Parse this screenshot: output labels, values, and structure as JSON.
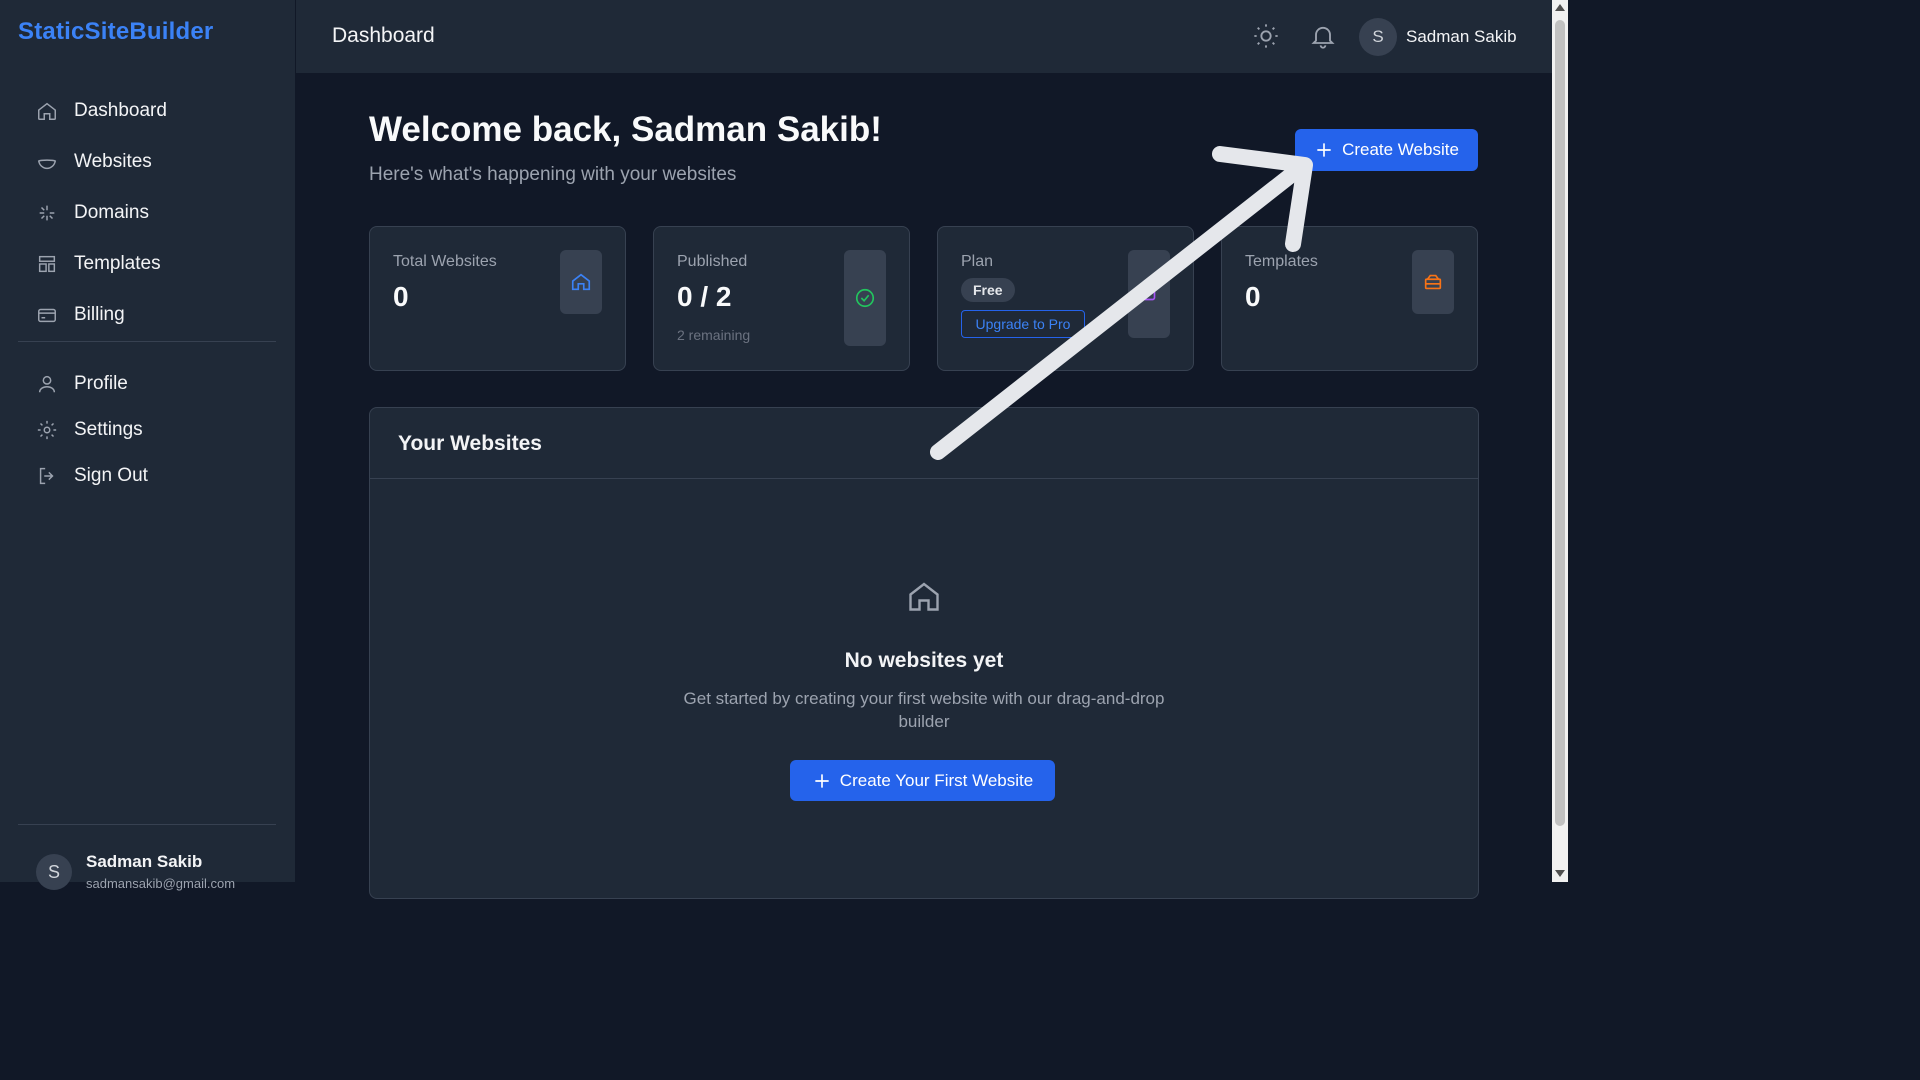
{
  "brand": "StaticSiteBuilder",
  "nav": {
    "primary": [
      {
        "label": "Dashboard",
        "icon": "home-icon"
      },
      {
        "label": "Websites",
        "icon": "bowl-icon"
      },
      {
        "label": "Domains",
        "icon": "sparkle-icon"
      },
      {
        "label": "Templates",
        "icon": "layout-icon"
      },
      {
        "label": "Billing",
        "icon": "credit-card-icon"
      }
    ],
    "secondary": [
      {
        "label": "Profile",
        "icon": "user-icon"
      },
      {
        "label": "Settings",
        "icon": "gear-icon"
      },
      {
        "label": "Sign Out",
        "icon": "sign-out-icon"
      }
    ]
  },
  "sidebar_user": {
    "initial": "S",
    "name": "Sadman Sakib",
    "email": "sadmansakib@gmail.com"
  },
  "topbar": {
    "title": "Dashboard",
    "user_initial": "S",
    "user_name": "Sadman Sakib"
  },
  "main": {
    "welcome": "Welcome back, Sadman Sakib!",
    "subtitle": "Here's what's happening with your websites",
    "create_button": "Create Website"
  },
  "stats": {
    "total": {
      "label": "Total Websites",
      "value": "0",
      "icon_color": "#3b82f6"
    },
    "published": {
      "label": "Published",
      "value": "0 / 2",
      "note": "2 remaining",
      "icon_color": "#22c55e"
    },
    "plan": {
      "label": "Plan",
      "badge": "Free",
      "upgrade": "Upgrade to Pro",
      "icon_color": "#a855f7"
    },
    "templates": {
      "label": "Templates",
      "value": "0",
      "icon_color": "#f97316"
    }
  },
  "websites_panel": {
    "title": "Your Websites",
    "empty_title": "No websites yet",
    "empty_desc": "Get started by creating your first website with our drag-and-drop builder",
    "first_button": "Create Your First Website"
  },
  "colors": {
    "accent": "#2563eb",
    "brand": "#3b82f6",
    "bg": "#111827",
    "surface": "#1f2937"
  }
}
